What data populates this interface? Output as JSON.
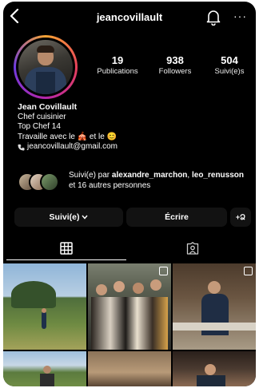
{
  "header": {
    "username": "jeancovillault",
    "back_icon": "chevron-left-icon",
    "bell_icon": "bell-icon",
    "more_icon": "more-icon"
  },
  "stats": [
    {
      "value": "19",
      "label": "Publications"
    },
    {
      "value": "938",
      "label": "Followers"
    },
    {
      "value": "504",
      "label": "Suivi(e)s"
    }
  ],
  "bio": {
    "name": "Jean Covillault",
    "line1": "Chef cuisinier",
    "line2": "Top Chef 14",
    "line3_prefix": "Travaille avec le",
    "line3_mid": "et le",
    "emoji1": "🎪",
    "emoji2": "😊",
    "email": "jeancovillault@gmail.com"
  },
  "followed_by": {
    "prefix": "Suivi(e) par",
    "user1": "alexandre_marchon",
    "sep": ",",
    "user2": "leo_renusson",
    "suffix": "et 16 autres personnes"
  },
  "buttons": {
    "following_label": "Suivi(e)",
    "message_label": "Écrire",
    "add_user_label": "+Ձ"
  },
  "tabs": [
    {
      "icon": "grid-icon"
    },
    {
      "icon": "tagged-icon"
    }
  ],
  "colors": {
    "background": "#000000",
    "button": "#121212",
    "ring_start": "#f9a533",
    "ring_end": "#b426a8"
  }
}
